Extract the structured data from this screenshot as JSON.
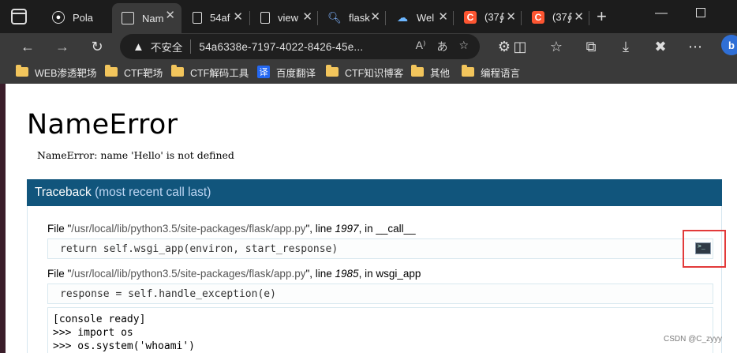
{
  "tabs": [
    {
      "label": "Pola",
      "icon": "github-icon"
    },
    {
      "label": "Nam",
      "icon": "terminal-icon",
      "active": true
    },
    {
      "label": "54af",
      "icon": "document-icon"
    },
    {
      "label": "view",
      "icon": "document-icon"
    },
    {
      "label": "flask",
      "icon": "search-icon"
    },
    {
      "label": "Wel",
      "icon": "cloud-icon"
    },
    {
      "label": "(37∮",
      "icon": "csdn-icon"
    },
    {
      "label": "(37∮",
      "icon": "csdn-icon"
    }
  ],
  "omnibox": {
    "security_label": "不安全",
    "url": "54a6338e-7197-4022-8426-45e..."
  },
  "bookmarks": [
    {
      "label": "WEB渗透靶场",
      "icon": "folder-icon"
    },
    {
      "label": "CTF靶场",
      "icon": "folder-icon"
    },
    {
      "label": "CTF解码工具",
      "icon": "folder-icon"
    },
    {
      "label": "百度翻译",
      "icon": "translate-icon"
    },
    {
      "label": "CTF知识博客",
      "icon": "folder-icon"
    },
    {
      "label": "其他",
      "icon": "folder-icon"
    },
    {
      "label": "编程语言",
      "icon": "folder-icon"
    }
  ],
  "page": {
    "title": "NameError",
    "message": "NameError: name 'Hello' is not defined",
    "traceback_title": "Traceback",
    "traceback_subtitle": "(most recent call last)",
    "frames": [
      {
        "file_prefix": "File \"",
        "path": "/usr/local/lib/python3.5/site-packages/flask/app.py",
        "line_prefix": "\", line ",
        "lineno": "1997",
        "in_prefix": ", in ",
        "func": "__call__",
        "code": "return self.wsgi_app(environ, start_response)"
      },
      {
        "file_prefix": "File \"",
        "path": "/usr/local/lib/python3.5/site-packages/flask/app.py",
        "line_prefix": "\", line ",
        "lineno": "1985",
        "in_prefix": ", in ",
        "func": "wsgi_app",
        "code": "response = self.handle_exception(e)"
      }
    ],
    "console_lines": [
      "[console ready]",
      ">>> import os",
      ">>> os.system('whoami')"
    ]
  },
  "watermark": "CSDN @C_zyyy",
  "colors": {
    "traceback_header": "#11557c",
    "highlight_border": "#e23a3a"
  }
}
